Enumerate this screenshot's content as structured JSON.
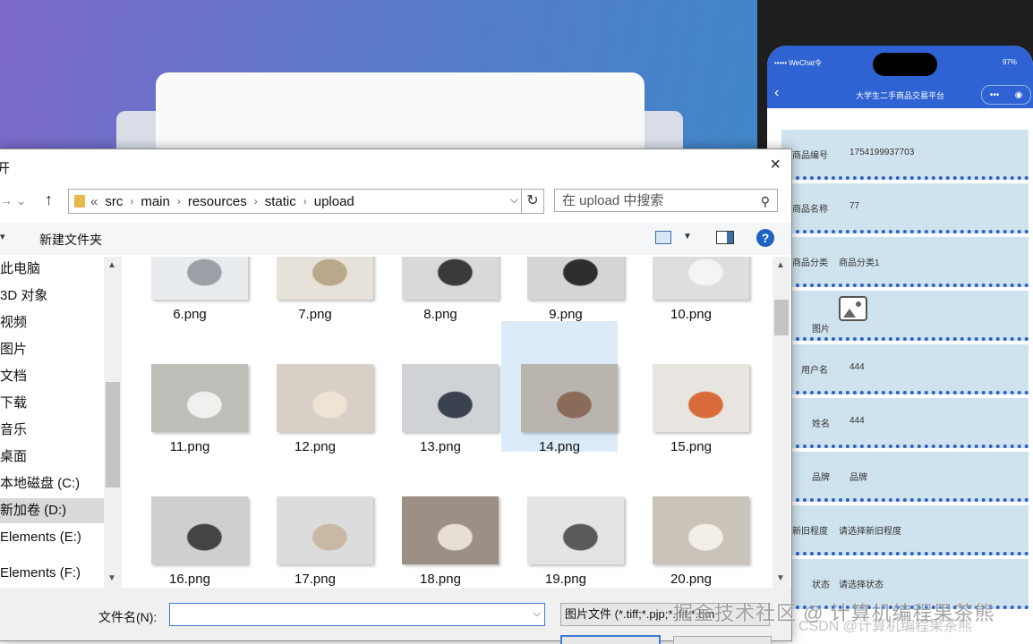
{
  "phone": {
    "carrier": "••••• WeChat令",
    "battery": "97%",
    "title": "大学生二手商品交易平台",
    "back": "‹",
    "capsule_dots": "•••",
    "capsule_close": "◉",
    "rows": [
      {
        "label": "商品编号",
        "value": "1754199937703"
      },
      {
        "label": "商品名称",
        "value": "77"
      },
      {
        "label": "商品分类",
        "value": "商品分类1"
      },
      {
        "label": "图片",
        "value": ""
      },
      {
        "label": "用户名",
        "value": "444"
      },
      {
        "label": "姓名",
        "value": "444"
      },
      {
        "label": "品牌",
        "value": "品牌"
      },
      {
        "label": "新旧程度",
        "value": "请选择新旧程度"
      },
      {
        "label": "状态",
        "value": "请选择状态"
      }
    ]
  },
  "dialog": {
    "title": "开",
    "close": "×",
    "nav_back_forward": "→ ⌄",
    "up": "↑",
    "breadcrumb_prefix": "«",
    "breadcrumb": [
      "src",
      "main",
      "resources",
      "static",
      "upload"
    ],
    "search_placeholder": "在 upload 中搜索",
    "toolbar_left": "▾",
    "new_folder": "新建文件夹",
    "help": "?",
    "sidebar": [
      "此电脑",
      "3D 对象",
      "视频",
      "图片",
      "文档",
      "下载",
      "音乐",
      "桌面",
      "本地磁盘 (C:)",
      "新加卷 (D:)",
      "Elements (E:)",
      "Elements (F:)"
    ],
    "sidebar_selected": 9,
    "files": [
      {
        "name": "6.png",
        "theme": "pens"
      },
      {
        "name": "7.png",
        "theme": "rolls"
      },
      {
        "name": "8.png",
        "theme": "calculator"
      },
      {
        "name": "9.png",
        "theme": "bag"
      },
      {
        "name": "10.png",
        "theme": "shoes"
      },
      {
        "name": "11.png",
        "theme": "fan"
      },
      {
        "name": "12.png",
        "theme": "microwave"
      },
      {
        "name": "13.png",
        "theme": "tablet"
      },
      {
        "name": "14.png",
        "theme": "mat"
      },
      {
        "name": "15.png",
        "theme": "book"
      },
      {
        "name": "16.png",
        "theme": "bike"
      },
      {
        "name": "17.png",
        "theme": "cups"
      },
      {
        "name": "18.png",
        "theme": "guitar"
      },
      {
        "name": "19.png",
        "theme": "racket"
      },
      {
        "name": "20.png",
        "theme": "lamp"
      }
    ],
    "selected_file": "14.png",
    "filename_label": "文件名(N):",
    "filename_value": "",
    "filetype": "图片文件 (*.tiff;*.pjp;*.jfif;*.bm"
  },
  "watermark": "掘金技术社区 @ 计算机编程果茶熊",
  "watermark2": "CSDN @计算机编程果茶熊",
  "colors": {
    "accent": "#2f63d3",
    "selection": "#dcebf8",
    "row_bg": "#cfe3ee"
  }
}
